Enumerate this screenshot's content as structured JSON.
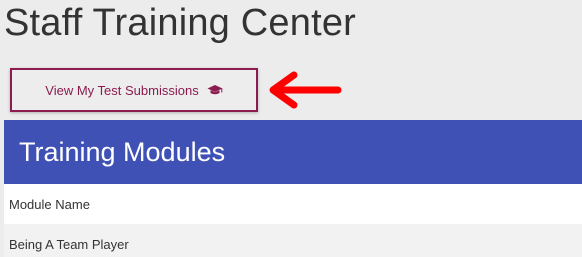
{
  "page": {
    "title": "Staff Training Center"
  },
  "toolbar": {
    "submissions_label": "View My Test Submissions",
    "submissions_icon": "graduation-cap-icon",
    "accent_color": "#8a1c4f"
  },
  "annotation": {
    "icon": "red-arrow-icon",
    "color": "#ff0000"
  },
  "modules": {
    "title": "Training Modules",
    "header_color": "#3f51b5",
    "columns": [
      "Module Name"
    ],
    "rows": [
      {
        "name": "Being A Team Player"
      }
    ]
  }
}
